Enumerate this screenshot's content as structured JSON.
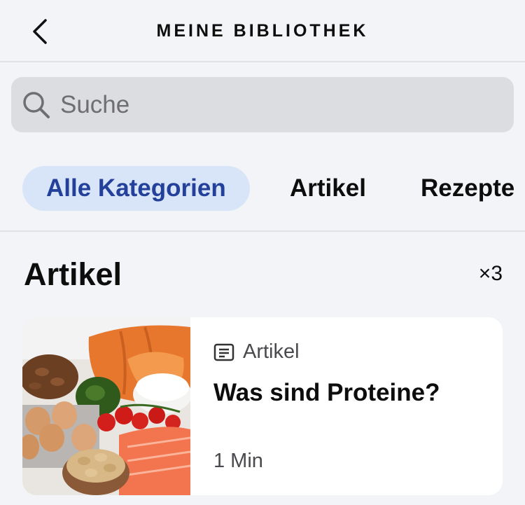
{
  "header": {
    "title": "MEINE BIBLIOTHEK",
    "back_icon": "chevron-left-icon"
  },
  "search": {
    "placeholder": "Suche",
    "value": "",
    "icon": "search-icon"
  },
  "tabs": [
    {
      "label": "Alle Kategorien",
      "active": true
    },
    {
      "label": "Artikel",
      "active": false
    },
    {
      "label": "Rezepte",
      "active": false
    }
  ],
  "section": {
    "title": "Artikel",
    "count": "3",
    "count_prefix": "×"
  },
  "card": {
    "type_label": "Artikel",
    "type_icon": "article-icon",
    "title": "Was sind Proteine?",
    "duration": "1 Min",
    "image": "protein-foods-photo"
  },
  "colors": {
    "background": "#f2f4f8",
    "active_tab_bg": "#d8e4f7",
    "active_tab_text": "#23409a",
    "search_bg": "#dcdde1",
    "card_bg": "#ffffff"
  }
}
